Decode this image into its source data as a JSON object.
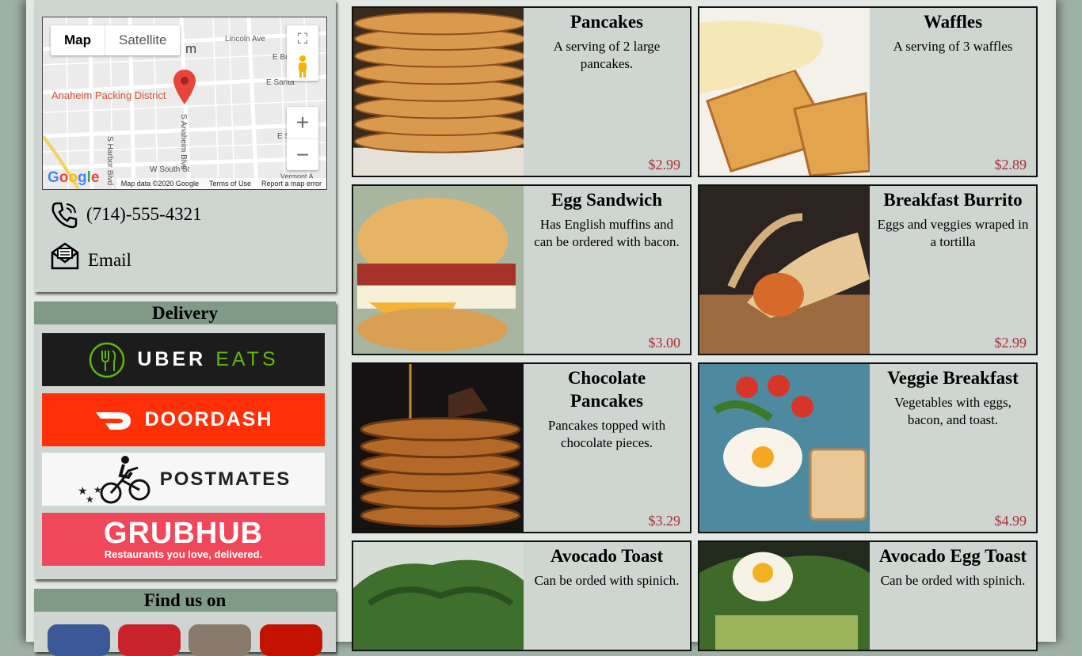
{
  "contact": {
    "map": {
      "type_map_label": "Map",
      "type_satellite_label": "Satellite",
      "marker_label": "Anaheim Packing District",
      "streets": [
        "Lincoln Ave",
        "E Broa",
        "E Santa",
        "S Harbor Blvd",
        "S Anaheim Blvd",
        "W South St",
        "Vermont A",
        "E S",
        "m"
      ],
      "google_logo": "Google",
      "footer": [
        "Map data ©2020 Google",
        "Terms of Use",
        "Report a map error"
      ],
      "zoom_in": "+",
      "zoom_out": "−"
    },
    "phone": "(714)-555-4321",
    "email": "Email"
  },
  "delivery": {
    "title": "Delivery",
    "providers": [
      {
        "name": "UBER EATS",
        "uber": "UBER",
        "eats": "EATS",
        "bg": "#1c1c1c",
        "accent": "#5fb709"
      },
      {
        "name": "DOORDASH",
        "bg": "#ff3008"
      },
      {
        "name": "POSTMATES",
        "bg": "#f7f7f7"
      },
      {
        "name": "GRUBHUB",
        "tagline": "Restaurants you love, delivered.",
        "bg": "#f0485a"
      }
    ]
  },
  "find": {
    "title": "Find us on",
    "socials": [
      {
        "name": "facebook-icon",
        "color": "#3b5998"
      },
      {
        "name": "pinterest-icon",
        "color": "#c8232c"
      },
      {
        "name": "instagram-icon",
        "color": "#8a7a6b"
      },
      {
        "name": "yelp-icon",
        "color": "#c41200"
      }
    ]
  },
  "menu": [
    {
      "name": "Pancakes",
      "desc": "A serving of 2 large pancakes.",
      "price": "$2.99"
    },
    {
      "name": "Waffles",
      "desc": "A serving of 3 waffles",
      "price": "$2.89"
    },
    {
      "name": "Egg Sandwich",
      "desc": "Has English muffins and can be ordered with bacon.",
      "price": "$3.00"
    },
    {
      "name": "Breakfast Burrito",
      "desc": "Eggs and veggies wraped in a tortilla",
      "price": "$2.99"
    },
    {
      "name": "Chocolate Pancakes",
      "desc": "Pancakes topped with chocolate pieces.",
      "price": "$3.29"
    },
    {
      "name": "Veggie Breakfast",
      "desc": "Vegetables with eggs, bacon, and toast.",
      "price": "$4.99"
    },
    {
      "name": "Avocado Toast",
      "desc": "Can be orded with spinich.",
      "price": ""
    },
    {
      "name": "Avocado Egg Toast",
      "desc": "Can be orded with spinich.",
      "price": ""
    }
  ]
}
